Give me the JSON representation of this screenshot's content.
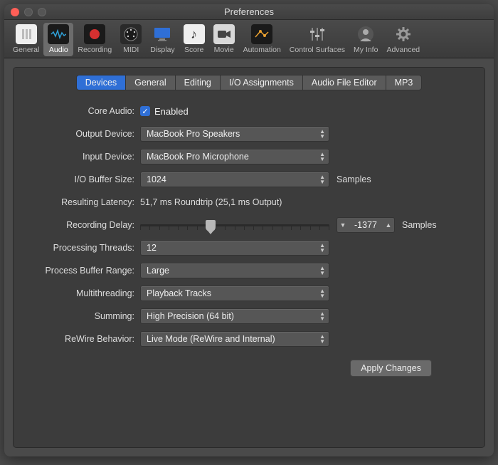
{
  "window": {
    "title": "Preferences"
  },
  "toolbar": {
    "items": [
      {
        "label": "General"
      },
      {
        "label": "Audio"
      },
      {
        "label": "Recording"
      },
      {
        "label": "MIDI"
      },
      {
        "label": "Display"
      },
      {
        "label": "Score"
      },
      {
        "label": "Movie"
      },
      {
        "label": "Automation"
      },
      {
        "label": "Control Surfaces"
      },
      {
        "label": "My Info"
      },
      {
        "label": "Advanced"
      }
    ]
  },
  "tabs": {
    "items": [
      "Devices",
      "General",
      "Editing",
      "I/O Assignments",
      "Audio File Editor",
      "MP3"
    ],
    "active": "Devices"
  },
  "form": {
    "core_audio": {
      "label": "Core Audio:",
      "enabled_label": "Enabled"
    },
    "output_device": {
      "label": "Output Device:",
      "value": "MacBook Pro Speakers"
    },
    "input_device": {
      "label": "Input Device:",
      "value": "MacBook Pro Microphone"
    },
    "io_buffer": {
      "label": "I/O Buffer Size:",
      "value": "1024",
      "unit": "Samples"
    },
    "latency": {
      "label": "Resulting Latency:",
      "value": "51,7 ms Roundtrip (25,1 ms Output)"
    },
    "recording_delay": {
      "label": "Recording Delay:",
      "value": "-1377",
      "unit": "Samples"
    },
    "processing_threads": {
      "label": "Processing Threads:",
      "value": "12"
    },
    "process_buffer_range": {
      "label": "Process Buffer Range:",
      "value": "Large"
    },
    "multithreading": {
      "label": "Multithreading:",
      "value": "Playback Tracks"
    },
    "summing": {
      "label": "Summing:",
      "value": "High Precision (64 bit)"
    },
    "rewire": {
      "label": "ReWire Behavior:",
      "value": "Live Mode (ReWire and Internal)"
    },
    "apply": "Apply Changes"
  }
}
